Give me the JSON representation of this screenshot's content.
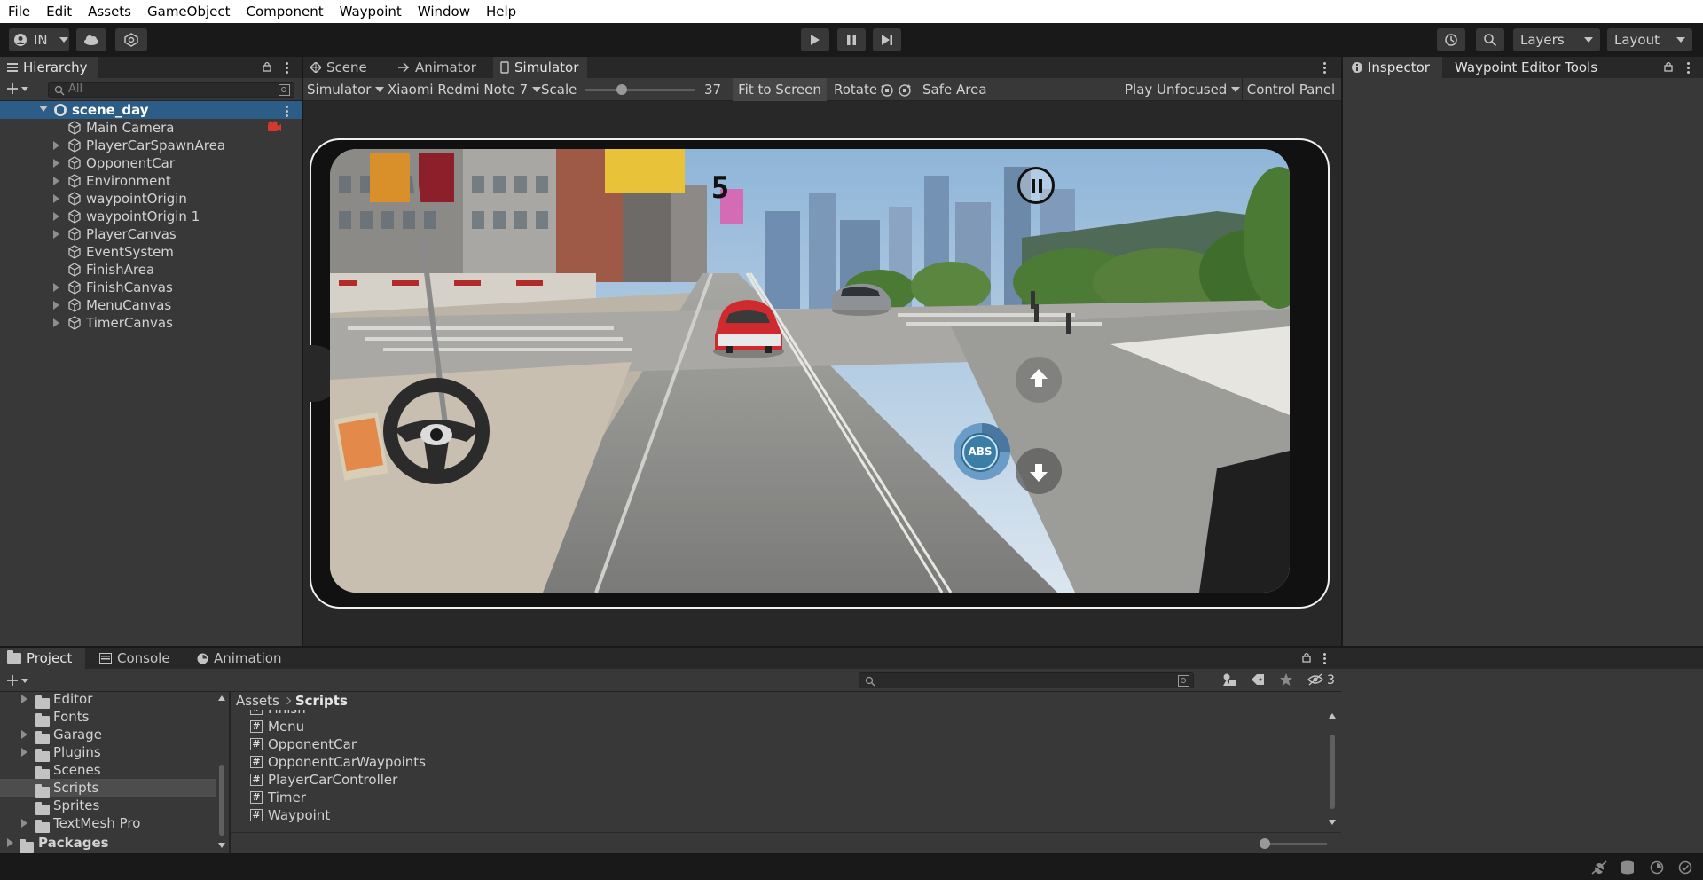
{
  "menu": [
    "File",
    "Edit",
    "Assets",
    "GameObject",
    "Component",
    "Waypoint",
    "Window",
    "Help"
  ],
  "toolbar": {
    "account_label": "IN",
    "layers_label": "Layers",
    "layout_label": "Layout"
  },
  "hierarchy": {
    "tab_label": "Hierarchy",
    "search_placeholder": "All",
    "scene_name": "scene_day",
    "items": [
      {
        "label": "Main Camera",
        "expandable": false
      },
      {
        "label": "PlayerCarSpawnArea",
        "expandable": true
      },
      {
        "label": "OpponentCar",
        "expandable": true
      },
      {
        "label": "Environment",
        "expandable": true
      },
      {
        "label": "waypointOrigin",
        "expandable": true
      },
      {
        "label": "waypointOrigin 1",
        "expandable": true
      },
      {
        "label": "PlayerCanvas",
        "expandable": true
      },
      {
        "label": "EventSystem",
        "expandable": false
      },
      {
        "label": "FinishArea",
        "expandable": false
      },
      {
        "label": "FinishCanvas",
        "expandable": true
      },
      {
        "label": "MenuCanvas",
        "expandable": true
      },
      {
        "label": "TimerCanvas",
        "expandable": true
      }
    ]
  },
  "center_tabs": [
    "Scene",
    "Animator",
    "Simulator"
  ],
  "simulator": {
    "mode_label": "Simulator",
    "device_label": "Xiaomi Redmi Note 7",
    "scale_label": "Scale",
    "scale_value": "37",
    "scale_fraction": 0.33,
    "fit_label": "Fit to Screen",
    "rotate_label": "Rotate",
    "safe_area_label": "Safe Area",
    "play_mode_label": "Play Unfocused",
    "control_panel_label": "Control Panel",
    "game": {
      "timer_text": "5",
      "abs_label": "ABS"
    }
  },
  "inspector": {
    "tab_label": "Inspector",
    "tools_tab_label": "Waypoint Editor Tools"
  },
  "project": {
    "tabs": [
      "Project",
      "Console",
      "Animation"
    ],
    "hidden_count": "3",
    "folders": [
      {
        "label": "Editor",
        "expandable": true
      },
      {
        "label": "Fonts",
        "expandable": false
      },
      {
        "label": "Garage",
        "expandable": true
      },
      {
        "label": "Plugins",
        "expandable": true
      },
      {
        "label": "Scenes",
        "expandable": false
      },
      {
        "label": "Scripts",
        "expandable": false,
        "selected": true
      },
      {
        "label": "Sprites",
        "expandable": false
      },
      {
        "label": "TextMesh Pro",
        "expandable": true
      }
    ],
    "packages_label": "Packages",
    "breadcrumb": [
      "Assets",
      "Scripts"
    ],
    "scripts": [
      "Finish",
      "Menu",
      "OpponentCar",
      "OpponentCarWaypoints",
      "PlayerCarController",
      "Timer",
      "Waypoint"
    ]
  }
}
